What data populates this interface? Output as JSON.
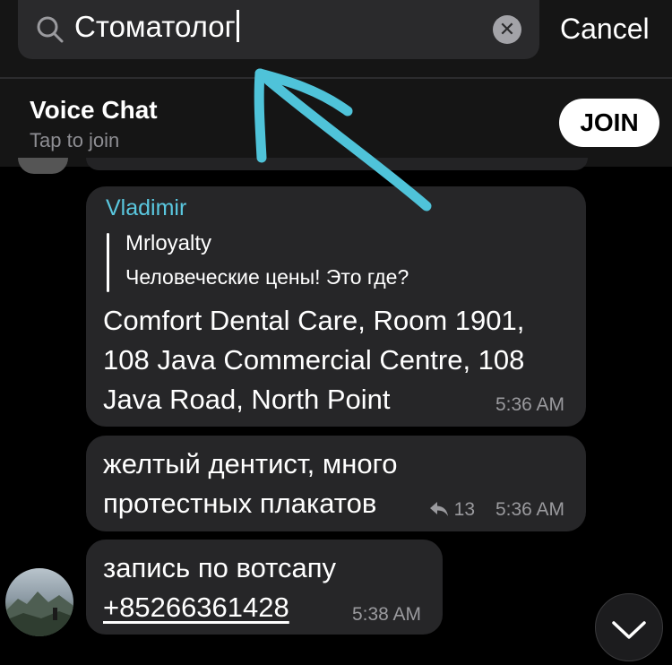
{
  "search": {
    "query": "Стоматолог",
    "cancel_label": "Cancel"
  },
  "voice_chat": {
    "title": "Voice Chat",
    "subtitle": "Tap to join",
    "join_label": "JOIN"
  },
  "messages": [
    {
      "sender": "Vladimir",
      "reply_to_name": "Mrloyalty",
      "reply_to_text": "Человеческие цены! Это где?",
      "text": "Comfort Dental Care, Room 1901,\n108 Java Commercial Centre, 108\nJava Road, North Point",
      "time": "5:36 AM"
    },
    {
      "text": "желтый дентист, много\nпротестных плакатов",
      "reply_count": "13",
      "time": "5:36 AM"
    },
    {
      "text_line1": "запись по вотсапу",
      "phone": "+85266361428",
      "time": "5:38 AM"
    }
  ],
  "colors": {
    "background": "#000000",
    "bubble": "#262628",
    "sender_name": "#5ac8e0",
    "annotation_arrow": "#4fc3d9"
  },
  "icons": [
    "search-icon",
    "clear-icon",
    "reply-arrow-icon",
    "chevron-down-icon"
  ]
}
